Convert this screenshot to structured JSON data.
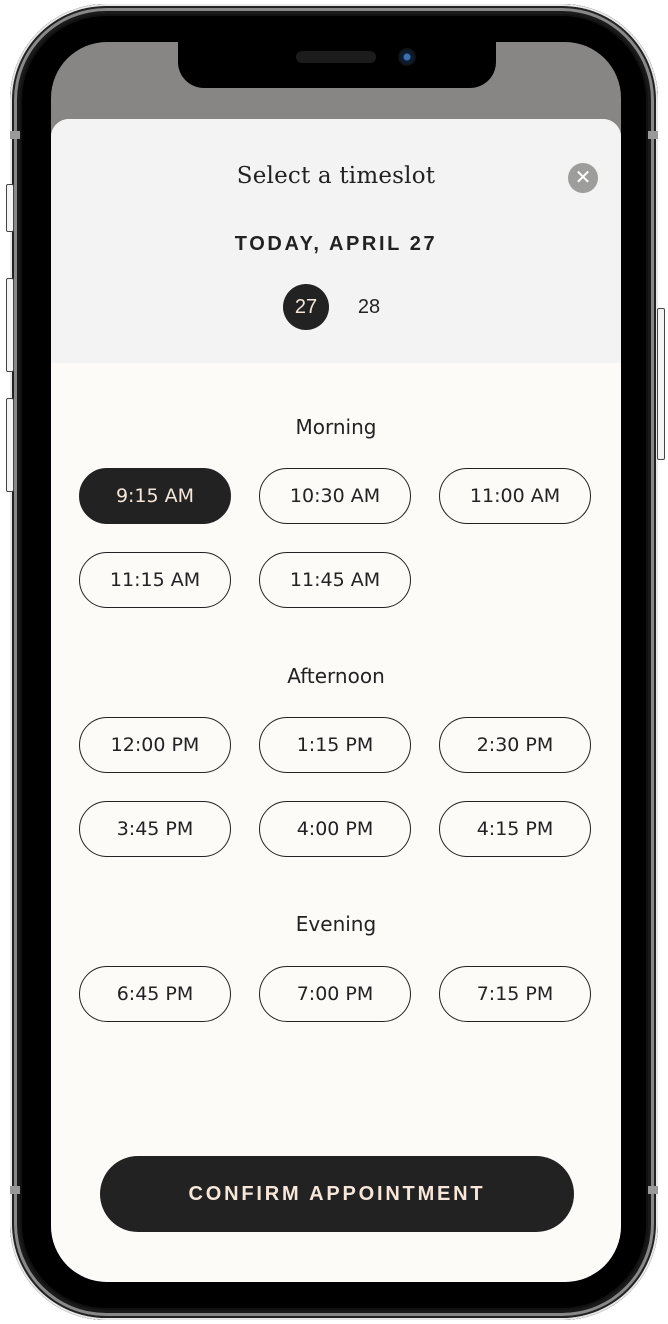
{
  "sheet": {
    "title": "Select a timeslot",
    "close_icon": "close-icon",
    "date_label": "TODAY, APRIL 27",
    "days": [
      {
        "label": "27",
        "selected": true
      },
      {
        "label": "28",
        "selected": false
      }
    ]
  },
  "sections": [
    {
      "title": "Morning",
      "slots": [
        {
          "label": "9:15 AM",
          "selected": true
        },
        {
          "label": "10:30 AM",
          "selected": false
        },
        {
          "label": "11:00 AM",
          "selected": false
        },
        {
          "label": "11:15 AM",
          "selected": false
        },
        {
          "label": "11:45 AM",
          "selected": false
        }
      ]
    },
    {
      "title": "Afternoon",
      "slots": [
        {
          "label": "12:00 PM",
          "selected": false
        },
        {
          "label": "1:15 PM",
          "selected": false
        },
        {
          "label": "2:30 PM",
          "selected": false
        },
        {
          "label": "3:45 PM",
          "selected": false
        },
        {
          "label": "4:00 PM",
          "selected": false
        },
        {
          "label": "4:15 PM",
          "selected": false
        }
      ]
    },
    {
      "title": "Evening",
      "slots": [
        {
          "label": "6:45 PM",
          "selected": false
        },
        {
          "label": "7:00 PM",
          "selected": false
        },
        {
          "label": "7:15 PM",
          "selected": false
        }
      ]
    }
  ],
  "confirm_label": "CONFIRM APPOINTMENT",
  "colors": {
    "accent_dark": "#222222",
    "accent_text": "#f6e7da",
    "sheet_bg": "#fdfbf8",
    "header_bg": "#f3f3f3",
    "close_bg": "#9d9d9b"
  }
}
